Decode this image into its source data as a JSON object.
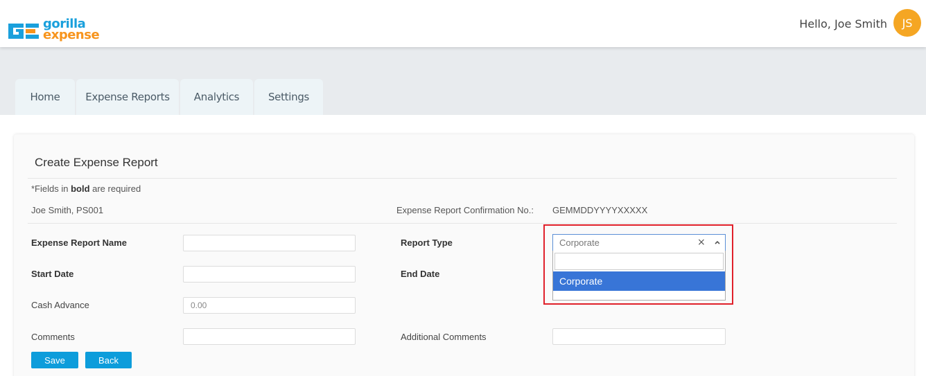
{
  "header": {
    "logo_line1": "gorilla",
    "logo_line2": "expense",
    "greeting": "Hello, Joe Smith",
    "avatar_initials": "JS"
  },
  "tabs": [
    "Home",
    "Expense Reports",
    "Analytics",
    "Settings"
  ],
  "form": {
    "title": "Create Expense Report",
    "required_note_prefix": "*Fields in ",
    "required_note_bold": "bold",
    "required_note_suffix": " are required",
    "user_info": "Joe Smith, PS001",
    "confirmation_label": "Expense Report Confirmation No.:",
    "confirmation_value": "GEMMDDYYYYXXXXX",
    "labels": {
      "report_name": "Expense Report Name",
      "report_type": "Report Type",
      "start_date": "Start Date",
      "end_date": "End Date",
      "cash_advance": "Cash Advance",
      "comments": "Comments",
      "additional_comments": "Additional Comments"
    },
    "values": {
      "report_name": "",
      "start_date": "",
      "cash_advance": "0.00",
      "comments": "",
      "additional_comments": ""
    },
    "report_type": {
      "selected": "Corporate",
      "search_value": "",
      "options": [
        "Corporate"
      ],
      "clear_glyph": "×"
    },
    "buttons": {
      "save": "Save",
      "back": "Back"
    }
  },
  "colors": {
    "accent": "#0d9ddb",
    "avatar": "#f5a623",
    "highlight": "#e0202a",
    "option_selected": "#3875d7"
  }
}
